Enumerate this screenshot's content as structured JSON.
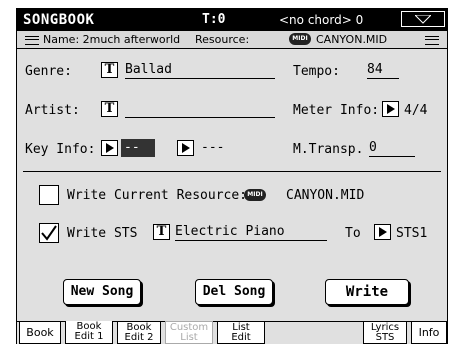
{
  "title_bar": {
    "app_name": "SONGBOOK",
    "tempo_readout": "T:0",
    "chord_readout": "<no chord> 0"
  },
  "info_bar": {
    "name": "Name: 2much afterworld",
    "resource_label": "Resource:",
    "resource_icon": "midi-disk-icon",
    "resource_badge": "MIDI",
    "resource_value": "CANYON.MID"
  },
  "fields": {
    "genre_label": "Genre:",
    "genre_value": "Ballad",
    "artist_label": "Artist:",
    "artist_value": "",
    "key_label": "Key Info:",
    "key_value_1": "--",
    "key_value_2": "---",
    "tempo_label": "Tempo:",
    "tempo_value": "84",
    "meter_label": "Meter Info:",
    "meter_value": "4/4",
    "mtransp_label": "M.Transp.",
    "mtransp_value": "0",
    "text_button": "T"
  },
  "options": {
    "write_resource_label": "Write Current Resource:",
    "write_resource_checked": false,
    "write_resource_value": "CANYON.MID",
    "write_sts_label": "Write STS",
    "write_sts_checked": true,
    "sts_name": "Electric Piano",
    "to_label": "To",
    "to_value": "STS1"
  },
  "buttons": {
    "new_song": "New Song",
    "del_song": "Del Song",
    "write": "Write"
  },
  "tabs": [
    {
      "line1": "Book",
      "line2": "",
      "state": "normal"
    },
    {
      "line1": "Book",
      "line2": "Edit 1",
      "state": "selected"
    },
    {
      "line1": "Book",
      "line2": "Edit 2",
      "state": "normal"
    },
    {
      "line1": "Custom",
      "line2": "List",
      "state": "disabled"
    },
    {
      "line1": "List",
      "line2": "Edit",
      "state": "normal"
    },
    {
      "line1": "Lyrics",
      "line2": "STS",
      "state": "normal"
    },
    {
      "line1": "Info",
      "line2": "",
      "state": "normal"
    }
  ],
  "colors": {
    "panel_bg": "#e0e0e0",
    "title_bg": "#000000",
    "highlight": "#333333"
  }
}
